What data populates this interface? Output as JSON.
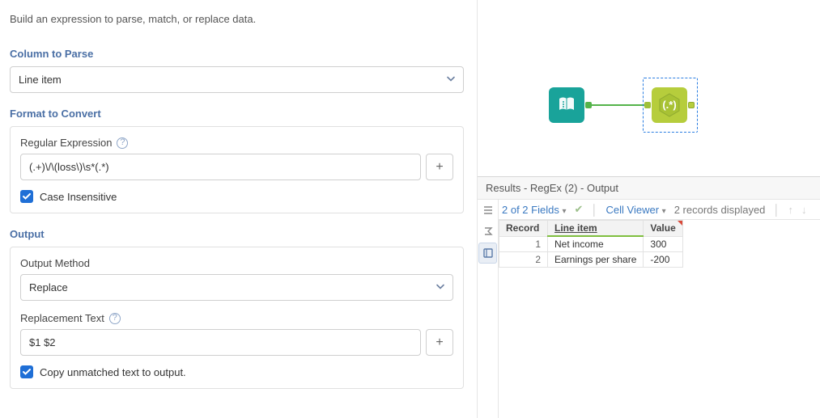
{
  "description": "Build an expression to parse, match, or replace data.",
  "columnToParse": {
    "label": "Column to Parse",
    "selected": "Line item"
  },
  "formatLabel": "Format to Convert",
  "regex": {
    "label": "Regular Expression",
    "value": "(.+)\\/\\(loss\\)\\s*(.*)"
  },
  "caseInsensitive": {
    "label": "Case Insensitive",
    "checked": true
  },
  "outputLabel": "Output",
  "outputMethod": {
    "label": "Output Method",
    "selected": "Replace"
  },
  "replacement": {
    "label": "Replacement Text",
    "value": "$1 $2"
  },
  "copyUnmatched": {
    "label": "Copy unmatched text to output.",
    "checked": true
  },
  "canvas": {
    "node1": "input-tool",
    "node2": "regex-tool"
  },
  "results": {
    "title": "Results - RegEx (2) - Output",
    "fieldsSummary": "2 of 2 Fields",
    "cellViewer": "Cell Viewer",
    "recordsDisplayed": "2 records displayed",
    "columns": [
      "Record",
      "Line item",
      "Value"
    ],
    "rows": [
      {
        "record": "1",
        "lineItem": "Net income",
        "value": "300"
      },
      {
        "record": "2",
        "lineItem": "Earnings per share",
        "value": "-200"
      }
    ]
  }
}
